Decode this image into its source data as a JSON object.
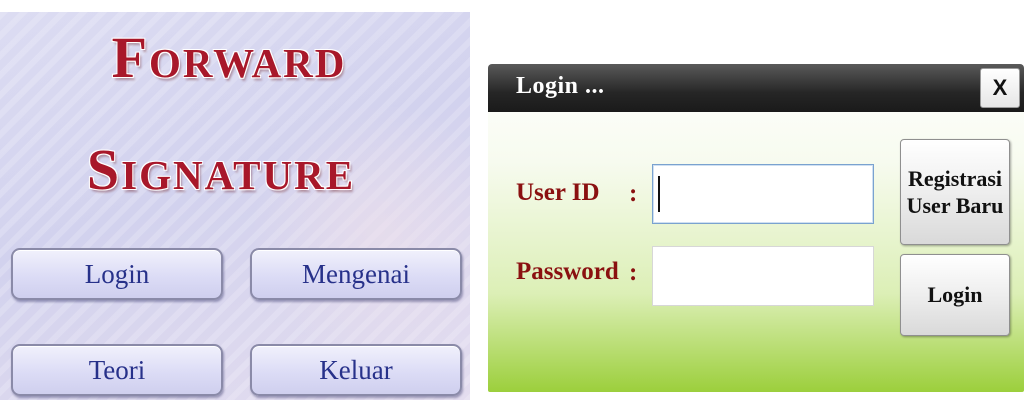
{
  "menu": {
    "brand_line1": "Forward",
    "brand_line2": "Signature",
    "buttons": {
      "login": "Login",
      "mengenai": "Mengenai",
      "teori": "Teori",
      "keluar": "Keluar"
    }
  },
  "login_dialog": {
    "title": "Login ...",
    "close_label": "X",
    "fields": {
      "userid_label": "User ID",
      "userid_colon": ":",
      "userid_value": "",
      "password_label": "Password",
      "password_colon": ":",
      "password_value": ""
    },
    "buttons": {
      "register_line1": "Registrasi",
      "register_line2": "User Baru",
      "login": "Login"
    }
  },
  "colors": {
    "brand_red": "#a8182a",
    "menu_button_text": "#27318a",
    "label_red": "#8a1010",
    "titlebar_dark": "#262626",
    "dialog_green": "#9ccf3c"
  },
  "icons": []
}
